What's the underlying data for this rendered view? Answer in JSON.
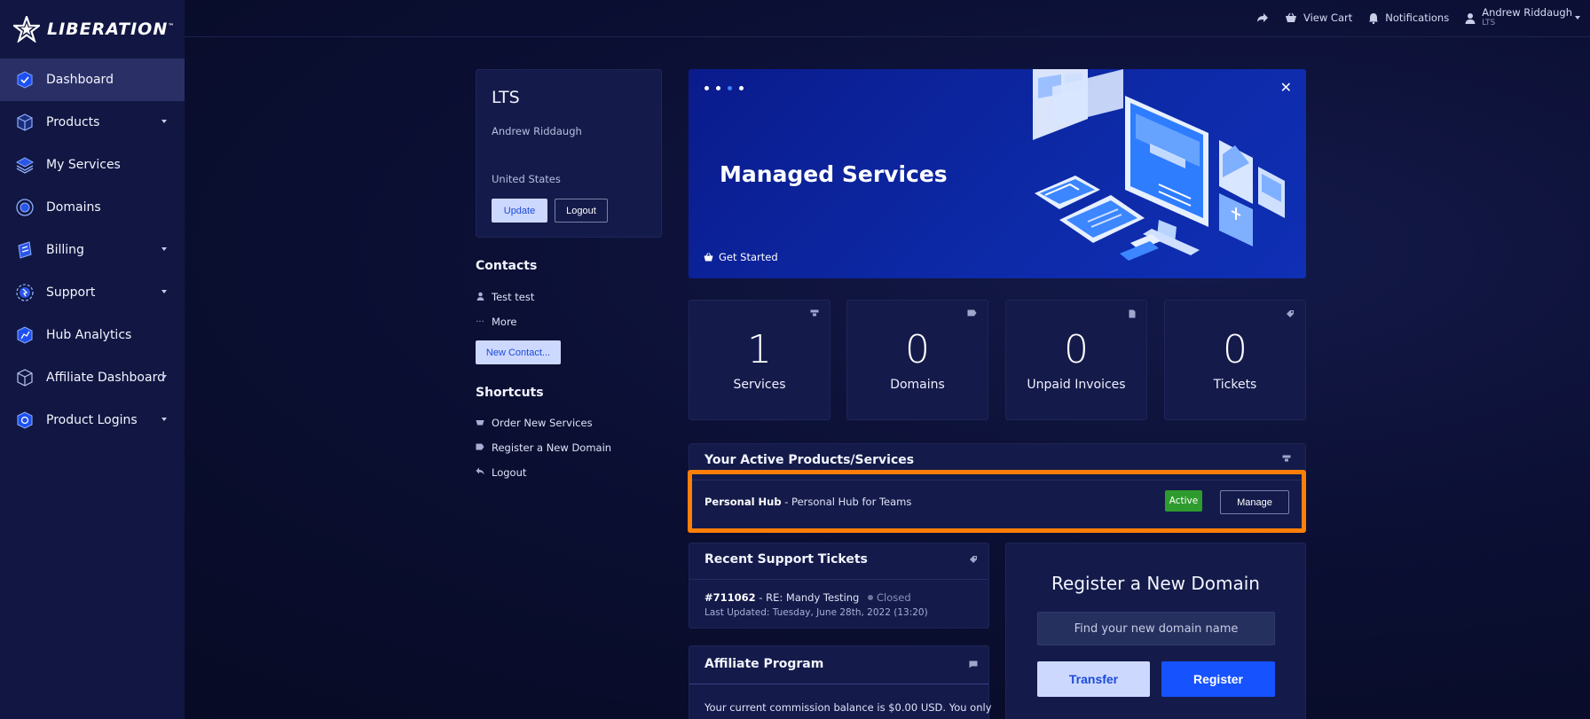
{
  "brand": {
    "name": "LIBERATION",
    "tm": "™"
  },
  "sidebar": {
    "items": [
      {
        "label": "Dashboard",
        "icon": "dashboard-icon",
        "active": true,
        "caret": false
      },
      {
        "label": "Products",
        "icon": "cube-icon",
        "caret": true
      },
      {
        "label": "My Services",
        "icon": "layers-icon",
        "caret": false
      },
      {
        "label": "Domains",
        "icon": "globe-icon",
        "caret": false
      },
      {
        "label": "Billing",
        "icon": "billing-icon",
        "caret": true
      },
      {
        "label": "Support",
        "icon": "support-icon",
        "caret": true
      },
      {
        "label": "Hub Analytics",
        "icon": "analytics-icon",
        "caret": false
      },
      {
        "label": "Affiliate Dashboard",
        "icon": "affiliate-icon",
        "caret": true
      },
      {
        "label": "Product Logins",
        "icon": "login-icon",
        "caret": true
      }
    ]
  },
  "topbar": {
    "view_cart": "View Cart",
    "notifications": "Notifications",
    "user_name": "Andrew Riddaugh",
    "user_company": "LTS"
  },
  "profile": {
    "company": "LTS",
    "name": "Andrew Riddaugh",
    "country": "United States",
    "update_label": "Update",
    "logout_label": "Logout"
  },
  "contacts": {
    "title": "Contacts",
    "items": [
      "Test test",
      "More"
    ],
    "new_contact_label": "New Contact..."
  },
  "shortcuts": {
    "title": "Shortcuts",
    "items": [
      "Order New Services",
      "Register a New Domain",
      "Logout"
    ]
  },
  "banner": {
    "title": "Managed Services",
    "cta": "Get Started",
    "slide_count": 4,
    "active_slide": 3
  },
  "stats": [
    {
      "value": "1",
      "label": "Services",
      "icon": "server-icon"
    },
    {
      "value": "0",
      "label": "Domains",
      "icon": "tag-icon"
    },
    {
      "value": "0",
      "label": "Unpaid Invoices",
      "icon": "document-icon"
    },
    {
      "value": "0",
      "label": "Tickets",
      "icon": "ticket-icon"
    }
  ],
  "active_products": {
    "title": "Your Active Products/Services",
    "product_name": "Personal Hub",
    "product_desc": " - Personal Hub for Teams",
    "status": "Active",
    "manage_label": "Manage"
  },
  "tickets": {
    "title": "Recent Support Tickets",
    "ticket_id": "#711062",
    "ticket_subject": " - RE: Mandy Testing",
    "ticket_status": "Closed",
    "last_updated": "Last Updated: Tuesday, June 28th, 2022 (13:20)"
  },
  "affiliate": {
    "title": "Affiliate Program",
    "text": "Your current commission balance is $0.00 USD. You only"
  },
  "domain_register": {
    "title": "Register a New Domain",
    "placeholder": "Find your new domain name",
    "transfer_label": "Transfer",
    "register_label": "Register"
  },
  "colors": {
    "accent": "#1653ff",
    "highlight": "#ff7e07",
    "active_badge": "#2e9b2e"
  }
}
